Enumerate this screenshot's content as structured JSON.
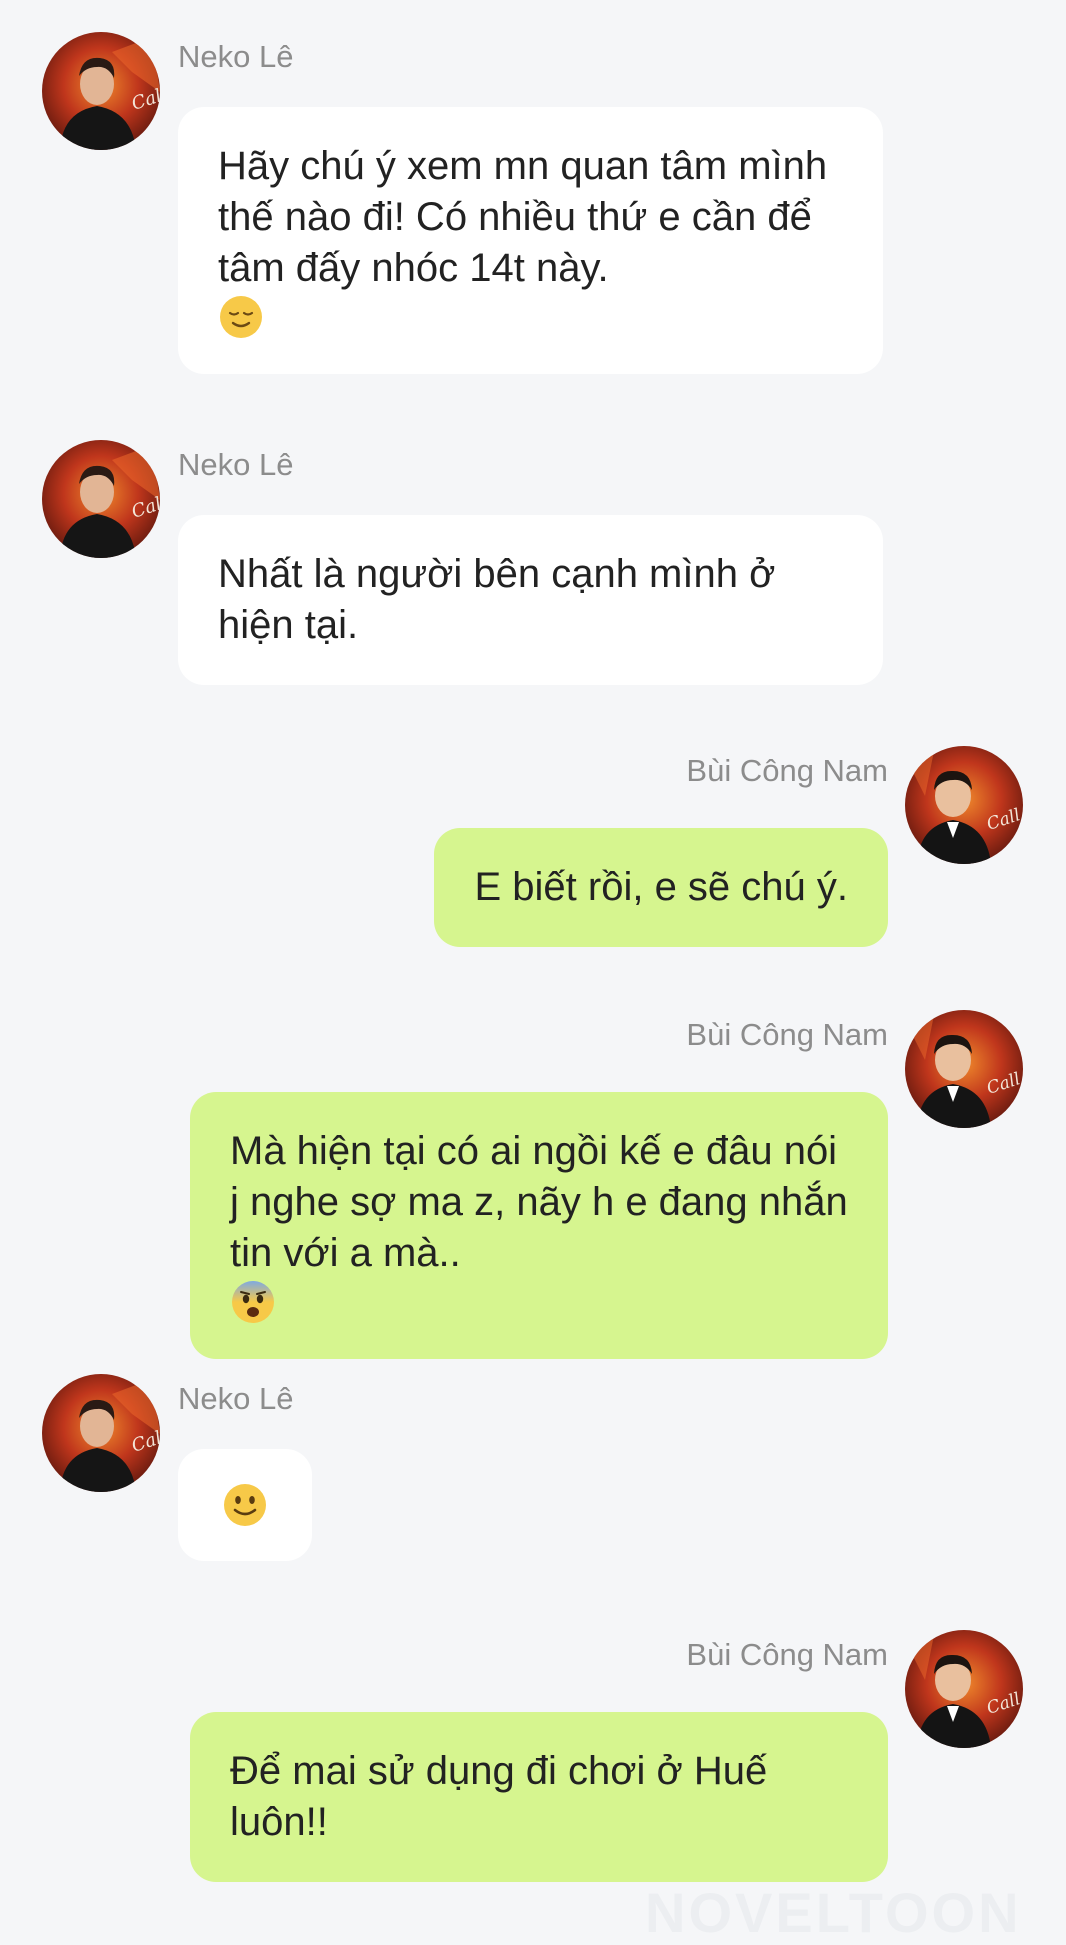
{
  "chat": {
    "messages": [
      {
        "sender": "Neko Lê",
        "side": "left",
        "text": "Hãy chú ý xem mn quan tâm mình thế nào đi! Có nhiều thứ e cần để tâm đấy nhóc 14t này.",
        "emoji": "relieved-face-emoji"
      },
      {
        "sender": "Neko Lê",
        "side": "left",
        "text": "Nhất là người bên cạnh mình ở hiện tại."
      },
      {
        "sender": "Bùi Công Nam",
        "side": "right",
        "text": "E biết rồi, e sẽ chú ý."
      },
      {
        "sender": "Bùi Công Nam",
        "side": "right",
        "text": "Mà hiện tại có ai ngồi kế e đâu nói j nghe sợ ma z, nãy h e đang nhắn tin với a mà..",
        "emoji": "fearful-face-emoji"
      },
      {
        "sender": "Neko Lê",
        "side": "left",
        "text": "",
        "emoji": "slightly-smiling-face-emoji"
      },
      {
        "sender": "Bùi Công Nam",
        "side": "right",
        "text": "Để mai sử dụng đi chơi ở Huế luôn!!"
      }
    ]
  },
  "colors": {
    "background": "#f5f6f8",
    "left_bubble": "#ffffff",
    "right_bubble": "#d6f58f",
    "name_text": "#8c8c8c",
    "message_text": "#222222"
  },
  "watermark": "NOVELTOON"
}
